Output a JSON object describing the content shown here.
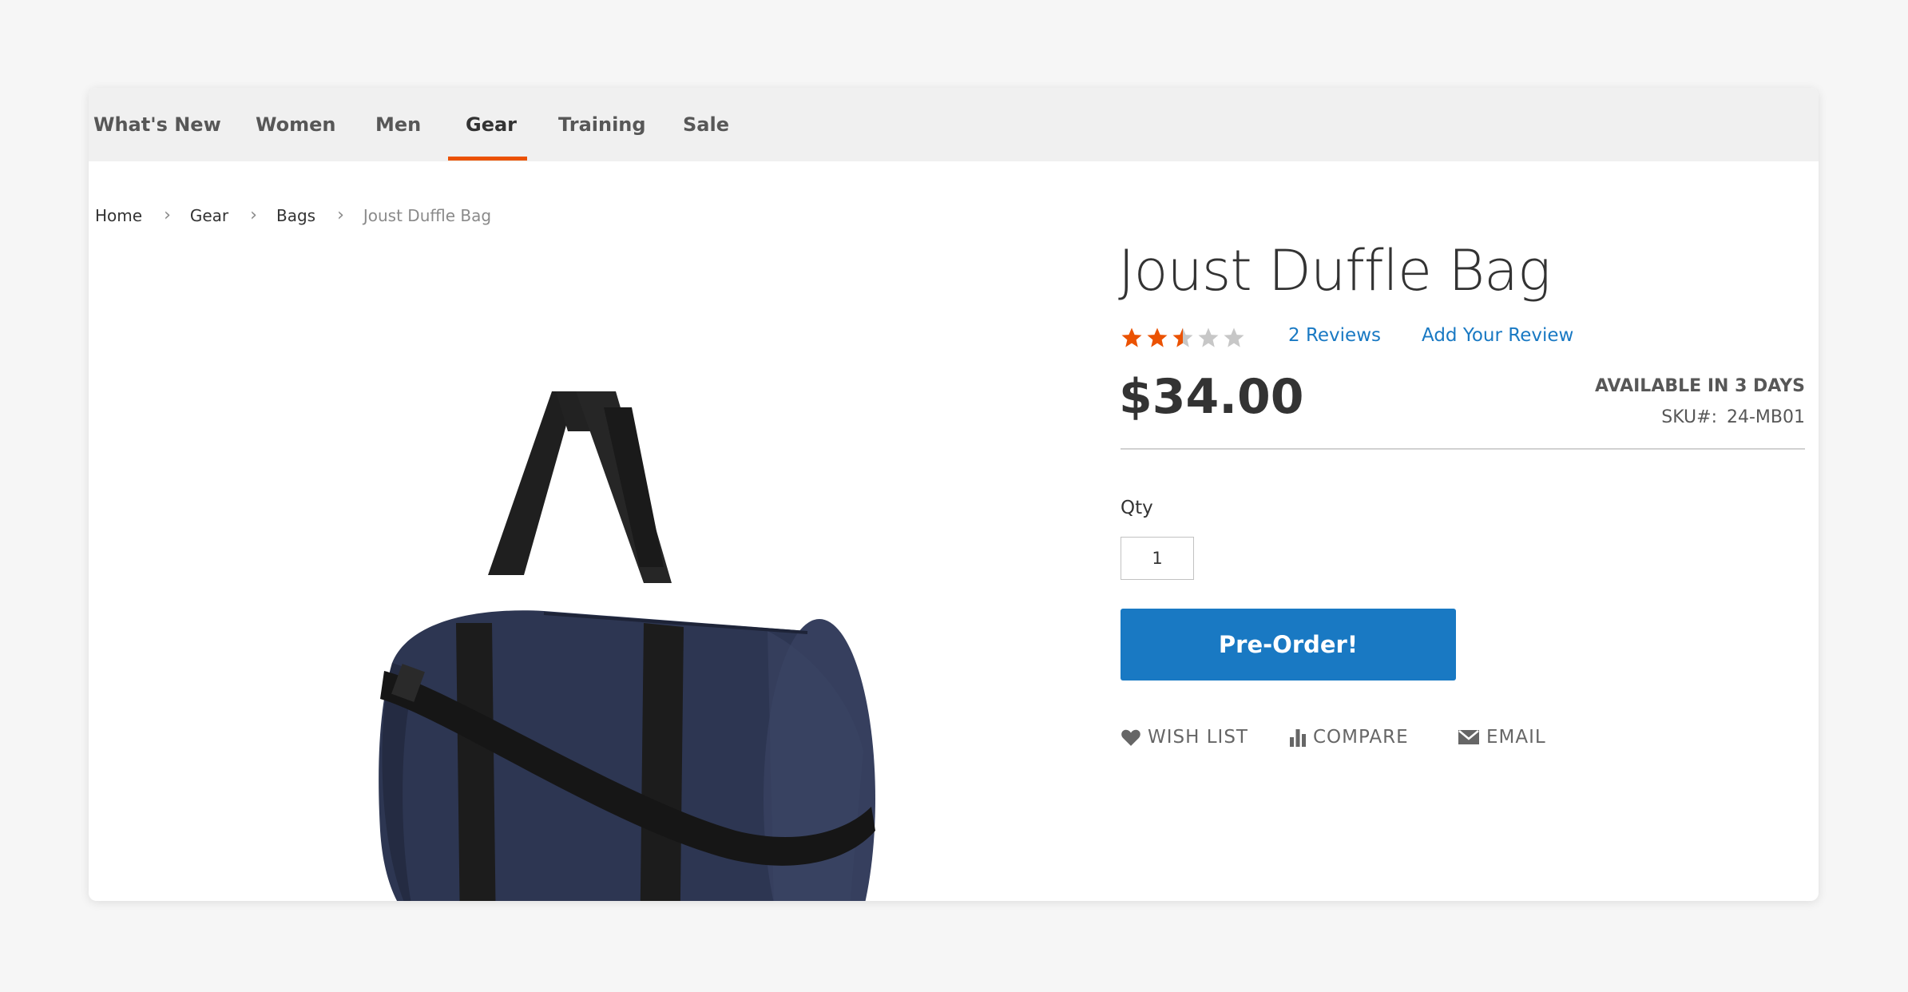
{
  "nav": {
    "items": [
      {
        "label": "What's New"
      },
      {
        "label": "Women"
      },
      {
        "label": "Men"
      },
      {
        "label": "Gear",
        "active": true
      },
      {
        "label": "Training"
      },
      {
        "label": "Sale"
      }
    ],
    "active_color": "#eb5202"
  },
  "breadcrumb": {
    "items": [
      "Home",
      "Gear",
      "Bags",
      "Joust Duffle Bag"
    ],
    "separator": "›"
  },
  "product": {
    "title": "Joust Duffle Bag",
    "rating_stars": 2.5,
    "rating_max": 5,
    "reviews_label": "2 Reviews",
    "add_review_label": "Add Your Review",
    "price": "$34.00",
    "availability": "AVAILABLE IN 3 DAYS",
    "sku_label": "SKU#:",
    "sku_value": "24-MB01",
    "image_icon": "duffle-bag-image"
  },
  "purchase": {
    "qty_label": "Qty",
    "qty_value": "1",
    "button_label": "Pre-Order!"
  },
  "actions": {
    "wishlist_label": "WISH LIST",
    "compare_label": "COMPARE",
    "email_label": "EMAIL"
  },
  "colors": {
    "accent": "#eb5202",
    "primary": "#1979c3",
    "star_filled": "#eb5202",
    "star_empty": "#c7c7c7"
  }
}
